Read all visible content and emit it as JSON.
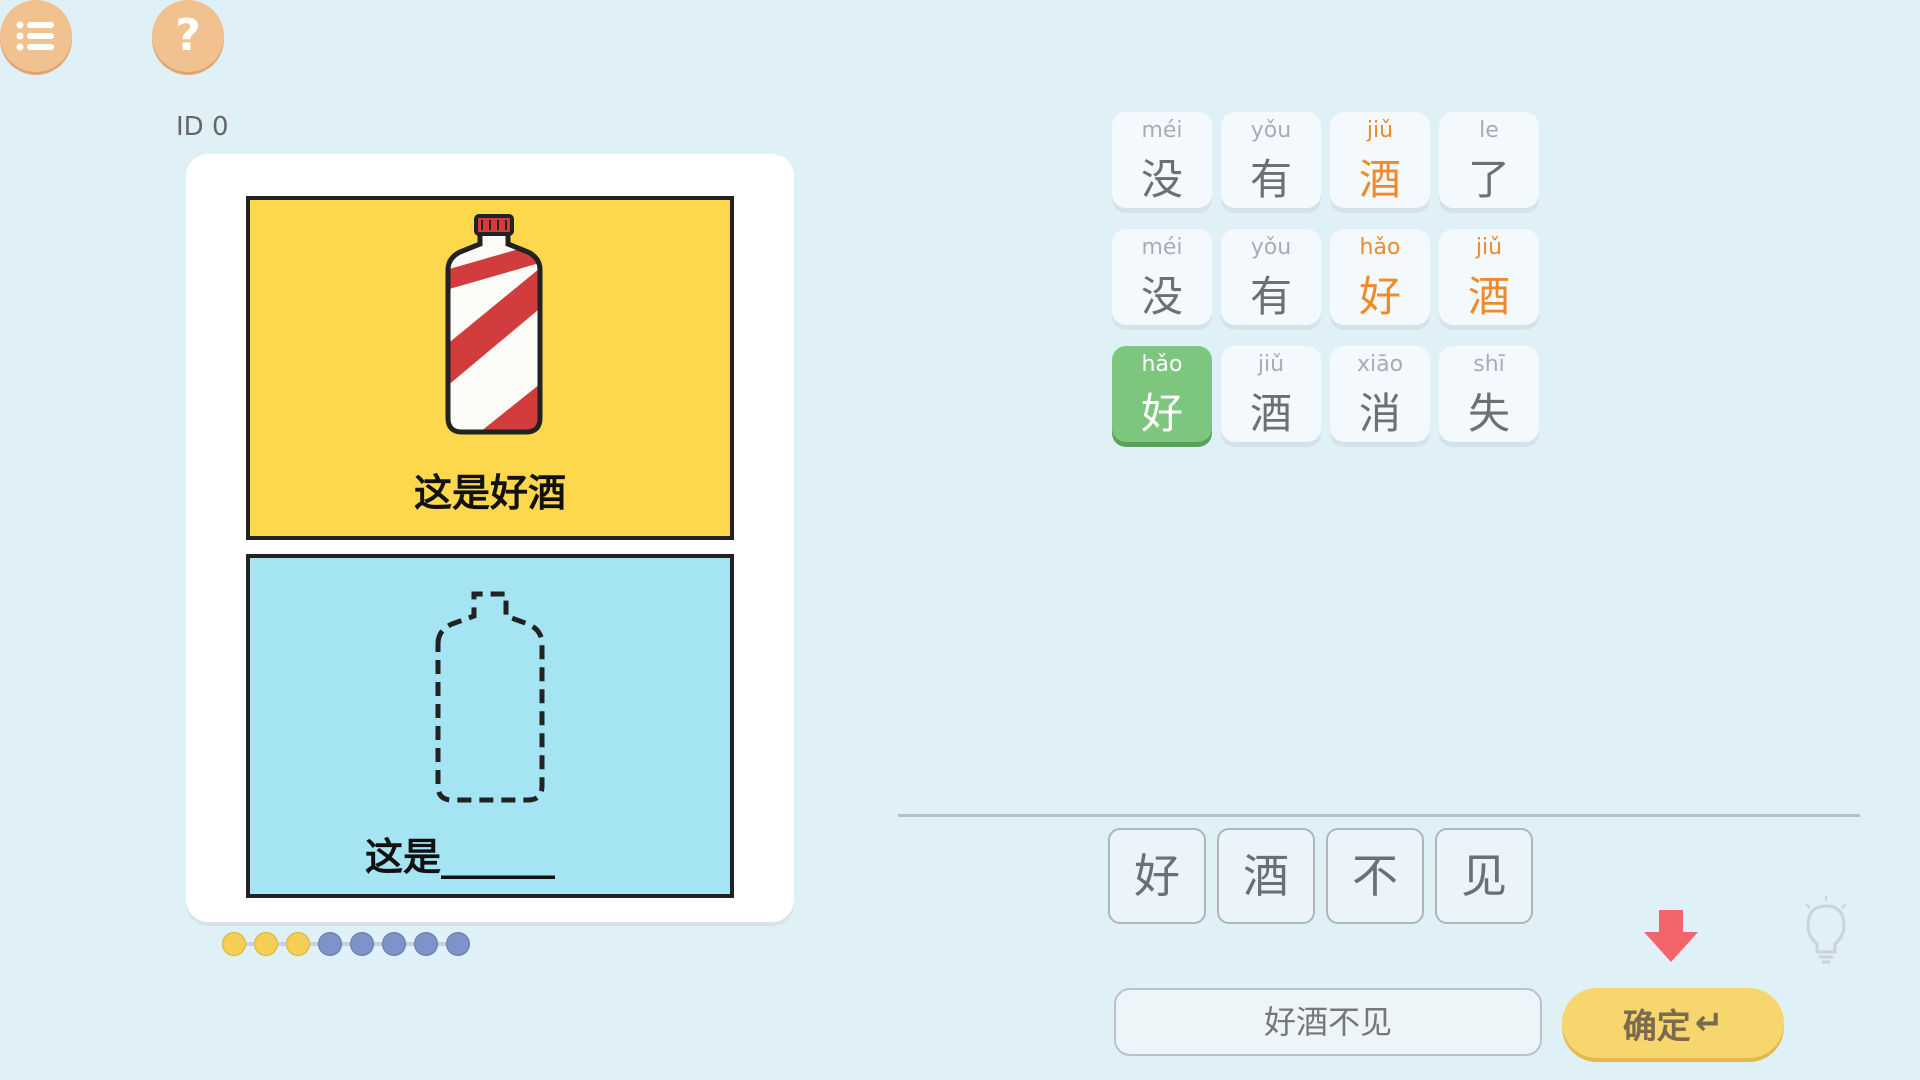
{
  "top_bar": {
    "menu_icon": "list-menu-icon",
    "help_label": "?"
  },
  "level": {
    "id_text": "ID 0"
  },
  "card": {
    "top_caption": "这是好酒",
    "bottom_caption": "这是______"
  },
  "progress": {
    "completed": 3,
    "total": 8
  },
  "tiles": [
    {
      "pinyin": "méi",
      "hanzi": "没",
      "state": "normal"
    },
    {
      "pinyin": "yǒu",
      "hanzi": "有",
      "state": "normal"
    },
    {
      "pinyin": "jiǔ",
      "hanzi": "酒",
      "state": "highlight"
    },
    {
      "pinyin": "le",
      "hanzi": "了",
      "state": "normal"
    },
    {
      "pinyin": "méi",
      "hanzi": "没",
      "state": "normal"
    },
    {
      "pinyin": "yǒu",
      "hanzi": "有",
      "state": "normal"
    },
    {
      "pinyin": "hǎo",
      "hanzi": "好",
      "state": "highlight"
    },
    {
      "pinyin": "jiǔ",
      "hanzi": "酒",
      "state": "highlight"
    },
    {
      "pinyin": "hǎo",
      "hanzi": "好",
      "state": "selected"
    },
    {
      "pinyin": "jiǔ",
      "hanzi": "酒",
      "state": "normal"
    },
    {
      "pinyin": "xiāo",
      "hanzi": "消",
      "state": "normal"
    },
    {
      "pinyin": "shī",
      "hanzi": "失",
      "state": "normal"
    }
  ],
  "answer_slots": [
    "好",
    "酒",
    "不",
    "见"
  ],
  "answer_box": {
    "value": "好酒不见"
  },
  "confirm": {
    "label": "确定",
    "icon": "enter-return-icon"
  },
  "colors": {
    "background": "#dff0f7",
    "top_panel": "#fdd84d",
    "bottom_panel": "#a4e4f3",
    "selected_tile": "#7cc67d",
    "highlight_text": "#ec8a2c",
    "confirm_button": "#f7d66e"
  }
}
